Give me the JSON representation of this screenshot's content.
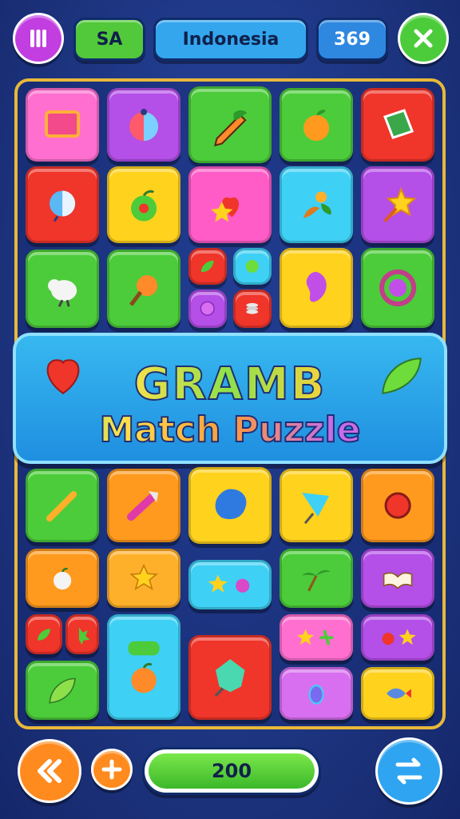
{
  "topbar": {
    "menu_icon": "pause-icon",
    "country_code": "SA",
    "country_name": "Indonesia",
    "score": "369",
    "close_icon": "close-icon"
  },
  "banner": {
    "title": "GRAMB",
    "subtitle": "Match Puzzle"
  },
  "bottombar": {
    "back_icon": "double-chevron-left-icon",
    "add_icon": "plus-icon",
    "progress_value": "200",
    "shuffle_icon": "swap-arrows-icon"
  },
  "colors": {
    "green": "#4ccc3a",
    "blue": "#2fa4f0",
    "purple": "#b44fe8",
    "pink": "#ff5cc8",
    "red": "#f0352a",
    "orange": "#ff9a1e",
    "yellow": "#ffd21e",
    "cyan": "#3ed0f5",
    "board_border": "#e8b83a"
  }
}
